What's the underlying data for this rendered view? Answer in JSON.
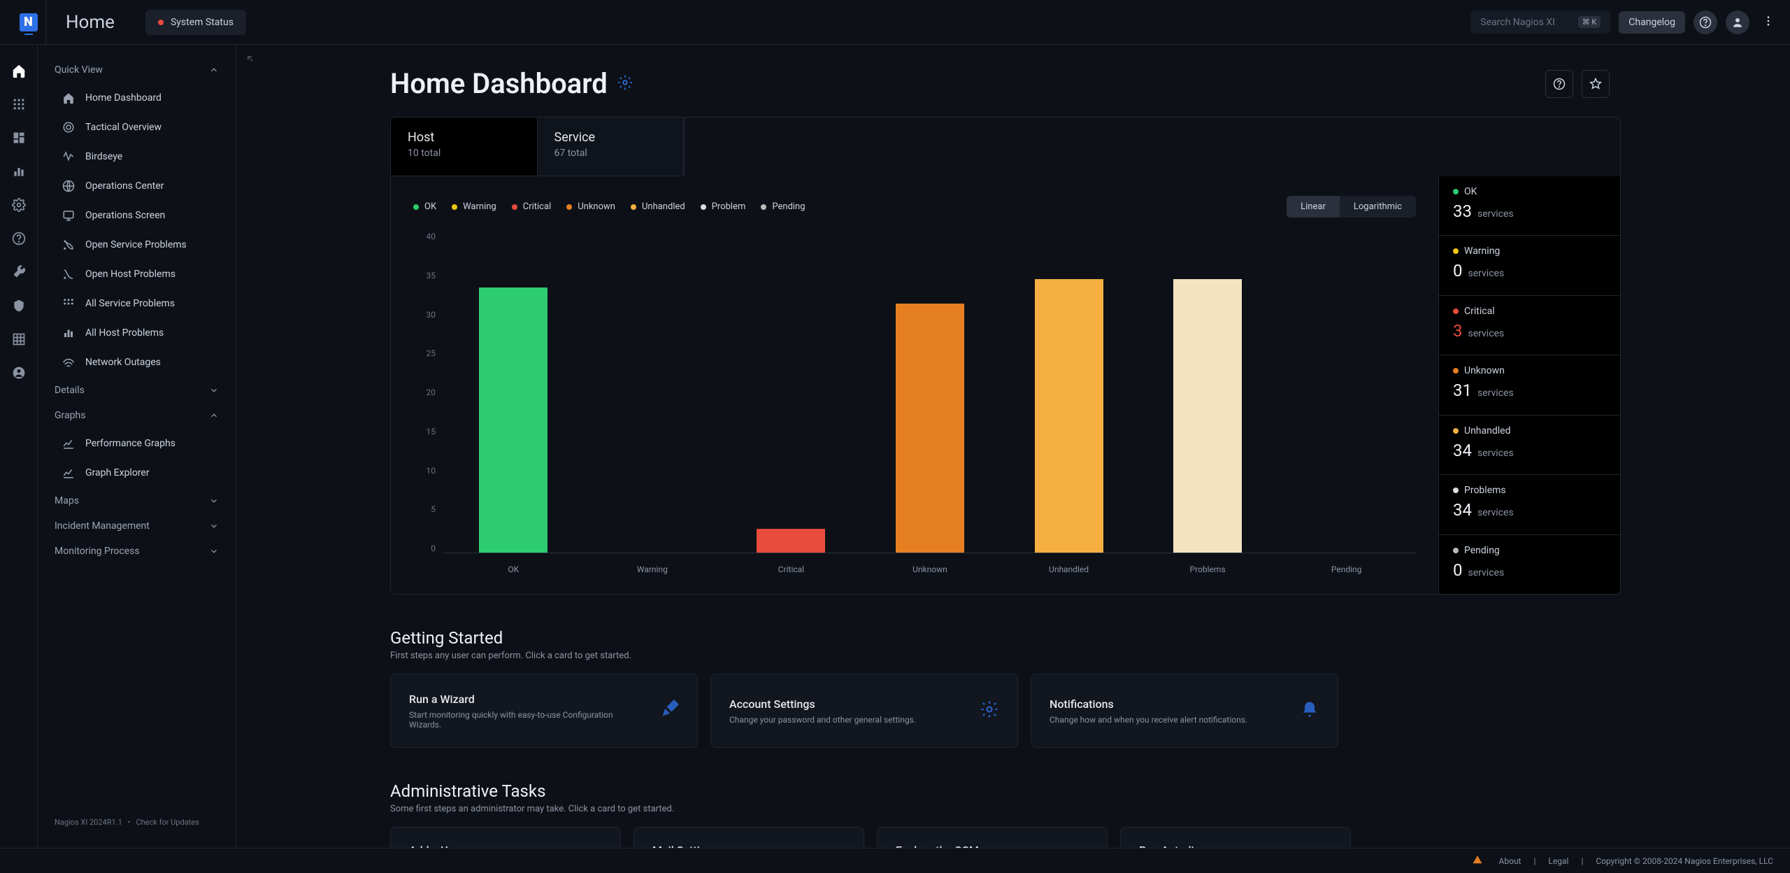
{
  "app": "Nagios XI",
  "topbar": {
    "title": "Home",
    "status_label": "System Status",
    "search_placeholder": "Search Nagios XI",
    "search_kbd": "⌘ K",
    "changelog": "Changelog"
  },
  "sidebar": {
    "sections": {
      "quick_view": "Quick View",
      "details": "Details",
      "graphs": "Graphs",
      "maps": "Maps",
      "incident": "Incident Management",
      "monitoring": "Monitoring Process"
    },
    "quick_items": [
      "Home Dashboard",
      "Tactical Overview",
      "Birdseye",
      "Operations Center",
      "Operations Screen",
      "Open Service Problems",
      "Open Host Problems",
      "All Service Problems",
      "All Host Problems",
      "Network Outages"
    ],
    "graph_items": [
      "Performance Graphs",
      "Graph Explorer"
    ],
    "version": "Nagios XI 2024R1.1",
    "check_updates": "Check for Updates"
  },
  "dashboard": {
    "title": "Home Dashboard",
    "tabs": [
      {
        "label": "Host",
        "sub": "10 total"
      },
      {
        "label": "Service",
        "sub": "67 total"
      }
    ],
    "legend": [
      "OK",
      "Warning",
      "Critical",
      "Unknown",
      "Unhandled",
      "Problem",
      "Pending"
    ],
    "scale": {
      "linear": "Linear",
      "log": "Logarithmic"
    },
    "stats": [
      {
        "label": "OK",
        "count": "33",
        "unit": "services",
        "color": "#2ecc71"
      },
      {
        "label": "Warning",
        "count": "0",
        "unit": "services",
        "color": "#f1c40f"
      },
      {
        "label": "Critical",
        "count": "3",
        "unit": "services",
        "color": "#e74c3c",
        "numcolor": "#e74c3c"
      },
      {
        "label": "Unknown",
        "count": "31",
        "unit": "services",
        "color": "#e67e22"
      },
      {
        "label": "Unhandled",
        "count": "34",
        "unit": "services",
        "color": "#f5b041"
      },
      {
        "label": "Problems",
        "count": "34",
        "unit": "services",
        "color": "#ddd"
      },
      {
        "label": "Pending",
        "count": "0",
        "unit": "services",
        "color": "#bbb"
      }
    ]
  },
  "chart_data": {
    "type": "bar",
    "categories": [
      "OK",
      "Warning",
      "Critical",
      "Unknown",
      "Unhandled",
      "Problems",
      "Pending"
    ],
    "values": [
      33,
      0,
      3,
      31,
      34,
      34,
      0
    ],
    "colors": [
      "#2ecc71",
      "#f1c40f",
      "#e74c3c",
      "#e67e22",
      "#f5b041",
      "#f4e3c1",
      "#bbb"
    ],
    "ylim": [
      0,
      40
    ],
    "yticks": [
      40,
      35,
      30,
      25,
      20,
      15,
      10,
      5,
      0
    ]
  },
  "getting_started": {
    "title": "Getting Started",
    "sub": "First steps any user can perform. Click a card to get started.",
    "cards": [
      {
        "title": "Run a Wizard",
        "desc": "Start monitoring quickly with easy-to-use Configuration Wizards."
      },
      {
        "title": "Account Settings",
        "desc": "Change your password and other general settings."
      },
      {
        "title": "Notifications",
        "desc": "Change how and when you receive alert notifications."
      }
    ]
  },
  "admin_tasks": {
    "title": "Administrative Tasks",
    "sub": "Some first steps an administrator may take. Click a card to get started.",
    "cards": [
      {
        "title": "Add a User"
      },
      {
        "title": "Mail Settings"
      },
      {
        "title": "Explore the CCM"
      },
      {
        "title": "Run Autodiscovery"
      }
    ]
  },
  "footer": {
    "about": "About",
    "legal": "Legal",
    "copyright": "Copyright © 2008-2024 Nagios Enterprises, LLC"
  }
}
